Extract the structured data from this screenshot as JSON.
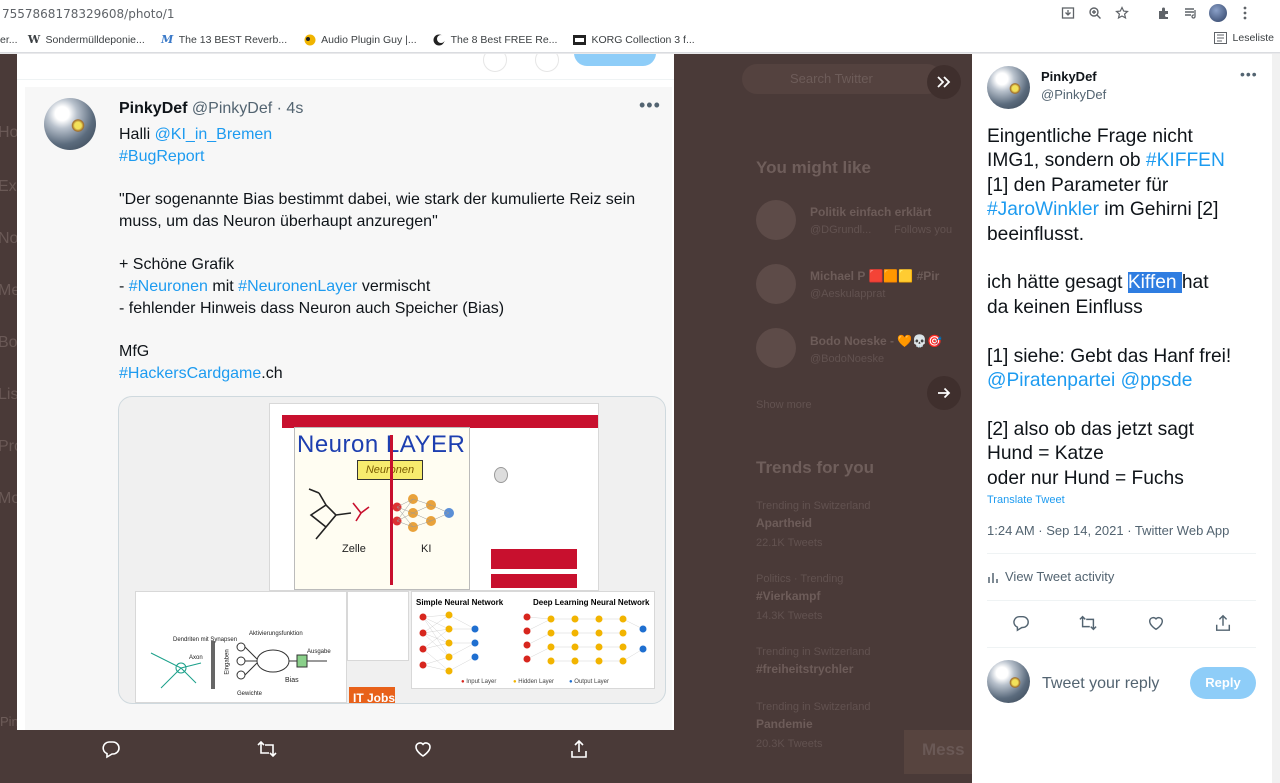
{
  "browser": {
    "url": "7557868178329608/photo/1",
    "bookmarks": [
      {
        "label": "er...",
        "icon": "page-icon"
      },
      {
        "label": "Sondermülldeponie...",
        "icon": "wikipedia-icon"
      },
      {
        "label": "The 13 BEST Reverb...",
        "icon": "m-logo-icon"
      },
      {
        "label": "Audio Plugin Guy |...",
        "icon": "audio-plugin-icon"
      },
      {
        "label": "The 8 Best FREE Re...",
        "icon": "moon-icon"
      },
      {
        "label": "KORG Collection 3 f...",
        "icon": "korg-icon"
      }
    ],
    "reading_list": "Leseliste"
  },
  "background": {
    "search_placeholder": "Search Twitter",
    "you_might_like": "You might like",
    "suggestions": [
      {
        "name": "Politik einfach erklärt",
        "handle": "@DGrundl...",
        "action": "Follows you"
      },
      {
        "name": "Michael P 🟥🟧🟨 #Pir",
        "handle": "@Aeskulapprat"
      },
      {
        "name": "Bodo Noeske - 🧡💀🎯",
        "handle": "@BodoNoeske"
      }
    ],
    "show_more": "Show more",
    "trends_title": "Trends for you",
    "trends": [
      {
        "context": "Trending in Switzerland",
        "name": "Apartheid",
        "count": "22.1K Tweets"
      },
      {
        "context": "Politics · Trending",
        "name": "#Vierkampf",
        "count": "14.3K Tweets"
      },
      {
        "context": "Trending in Switzerland",
        "name": "#freiheitstrychler",
        "count": ""
      },
      {
        "context": "Trending in Switzerland",
        "name": "Pandemie",
        "count": "20.3K Tweets"
      }
    ],
    "messages_label": "Mess",
    "left_handle": "PinkyDef",
    "left_letters": [
      "Ho",
      "Ex",
      "No",
      "Me",
      "Bo",
      "Lis",
      "Pro",
      "Mo"
    ]
  },
  "center_tweet": {
    "name": "PinkyDef",
    "handle": "@PinkyDef",
    "time": "· 4s",
    "lines": [
      [
        {
          "t": "Halli "
        },
        {
          "t": "@KI_in_Bremen",
          "link": true
        }
      ],
      [
        {
          "t": "#BugReport",
          "link": true
        }
      ],
      [
        {
          "t": ""
        }
      ],
      [
        {
          "t": "\"Der sogenannte Bias bestimmt dabei, wie stark der kumulierte Reiz sein"
        }
      ],
      [
        {
          "t": "muss, um das Neuron überhaupt anzuregen\""
        }
      ],
      [
        {
          "t": ""
        }
      ],
      [
        {
          "t": "+ Schöne Grafik"
        }
      ],
      [
        {
          "t": "- "
        },
        {
          "t": "#Neuronen",
          "link": true
        },
        {
          "t": " mit "
        },
        {
          "t": "#NeuronenLayer",
          "link": true
        },
        {
          "t": " vermischt"
        }
      ],
      [
        {
          "t": "- fehlender Hinweis dass Neuron auch Speicher (Bias)"
        }
      ],
      [
        {
          "t": ""
        }
      ],
      [
        {
          "t": "MfG"
        }
      ],
      [
        {
          "t": "#HackersCardgame",
          "link": true
        },
        {
          "t": ".ch"
        }
      ]
    ],
    "image": {
      "title": "Neuron LAYER",
      "label_neuronen": "Neuronen",
      "caption_zelle": "Zelle",
      "caption_ki": "KI",
      "simple_nn": "Simple Neural Network",
      "deep_nn": "Deep Learning Neural Network",
      "legend_input": "Input Layer",
      "legend_hidden": "Hidden Layer",
      "legend_output": "Output Layer",
      "it_jobs": "IT Jobs",
      "bias_label": "Bias",
      "activation_label": "Aktivierungsfunktion",
      "output_label": "Ausgabe",
      "weights_label": "Gewichte",
      "dendrites_label": "Dendriten mit Synapsen",
      "axon_label": "Axon",
      "inputs_label": "Eingaben"
    }
  },
  "right_tweet": {
    "name": "PinkyDef",
    "handle": "@PinkyDef",
    "lines": [
      [
        {
          "t": "Eingentliche Frage nicht"
        }
      ],
      [
        {
          "t": "IMG1, sondern ob "
        },
        {
          "t": "#KIFFEN",
          "link": true
        }
      ],
      [
        {
          "t": "[1] den Parameter für"
        }
      ],
      [
        {
          "t": "#JaroWinkler",
          "link": true
        },
        {
          "t": " im Gehirni [2]"
        }
      ],
      [
        {
          "t": "beeinflusst."
        }
      ],
      [
        {
          "t": ""
        }
      ],
      [
        {
          "t": "ich hätte gesagt "
        },
        {
          "t": "Kiffen ",
          "sel": true
        },
        {
          "t": "hat"
        }
      ],
      [
        {
          "t": "da keinen Einfluss"
        }
      ],
      [
        {
          "t": ""
        }
      ],
      [
        {
          "t": "[1] siehe: Gebt das Hanf frei!"
        }
      ],
      [
        {
          "t": "@Piratenpartei",
          "link": true
        },
        {
          "t": " "
        },
        {
          "t": "@ppsde",
          "link": true
        }
      ],
      [
        {
          "t": ""
        }
      ],
      [
        {
          "t": "[2] also ob das jetzt sagt"
        }
      ],
      [
        {
          "t": "Hund = Katze"
        }
      ],
      [
        {
          "t": "oder nur Hund = Fuchs"
        }
      ]
    ],
    "translate": "Translate Tweet",
    "meta": "1:24 AM · Sep 14, 2021 · Twitter Web App",
    "activity": "View Tweet activity",
    "reply_placeholder": "Tweet your reply",
    "reply_button": "Reply"
  },
  "colors": {
    "link": "#1d9bf0",
    "overlay": "#4a3a38",
    "reply_button": "#8ecdf8",
    "selection": "#2f7de1"
  }
}
